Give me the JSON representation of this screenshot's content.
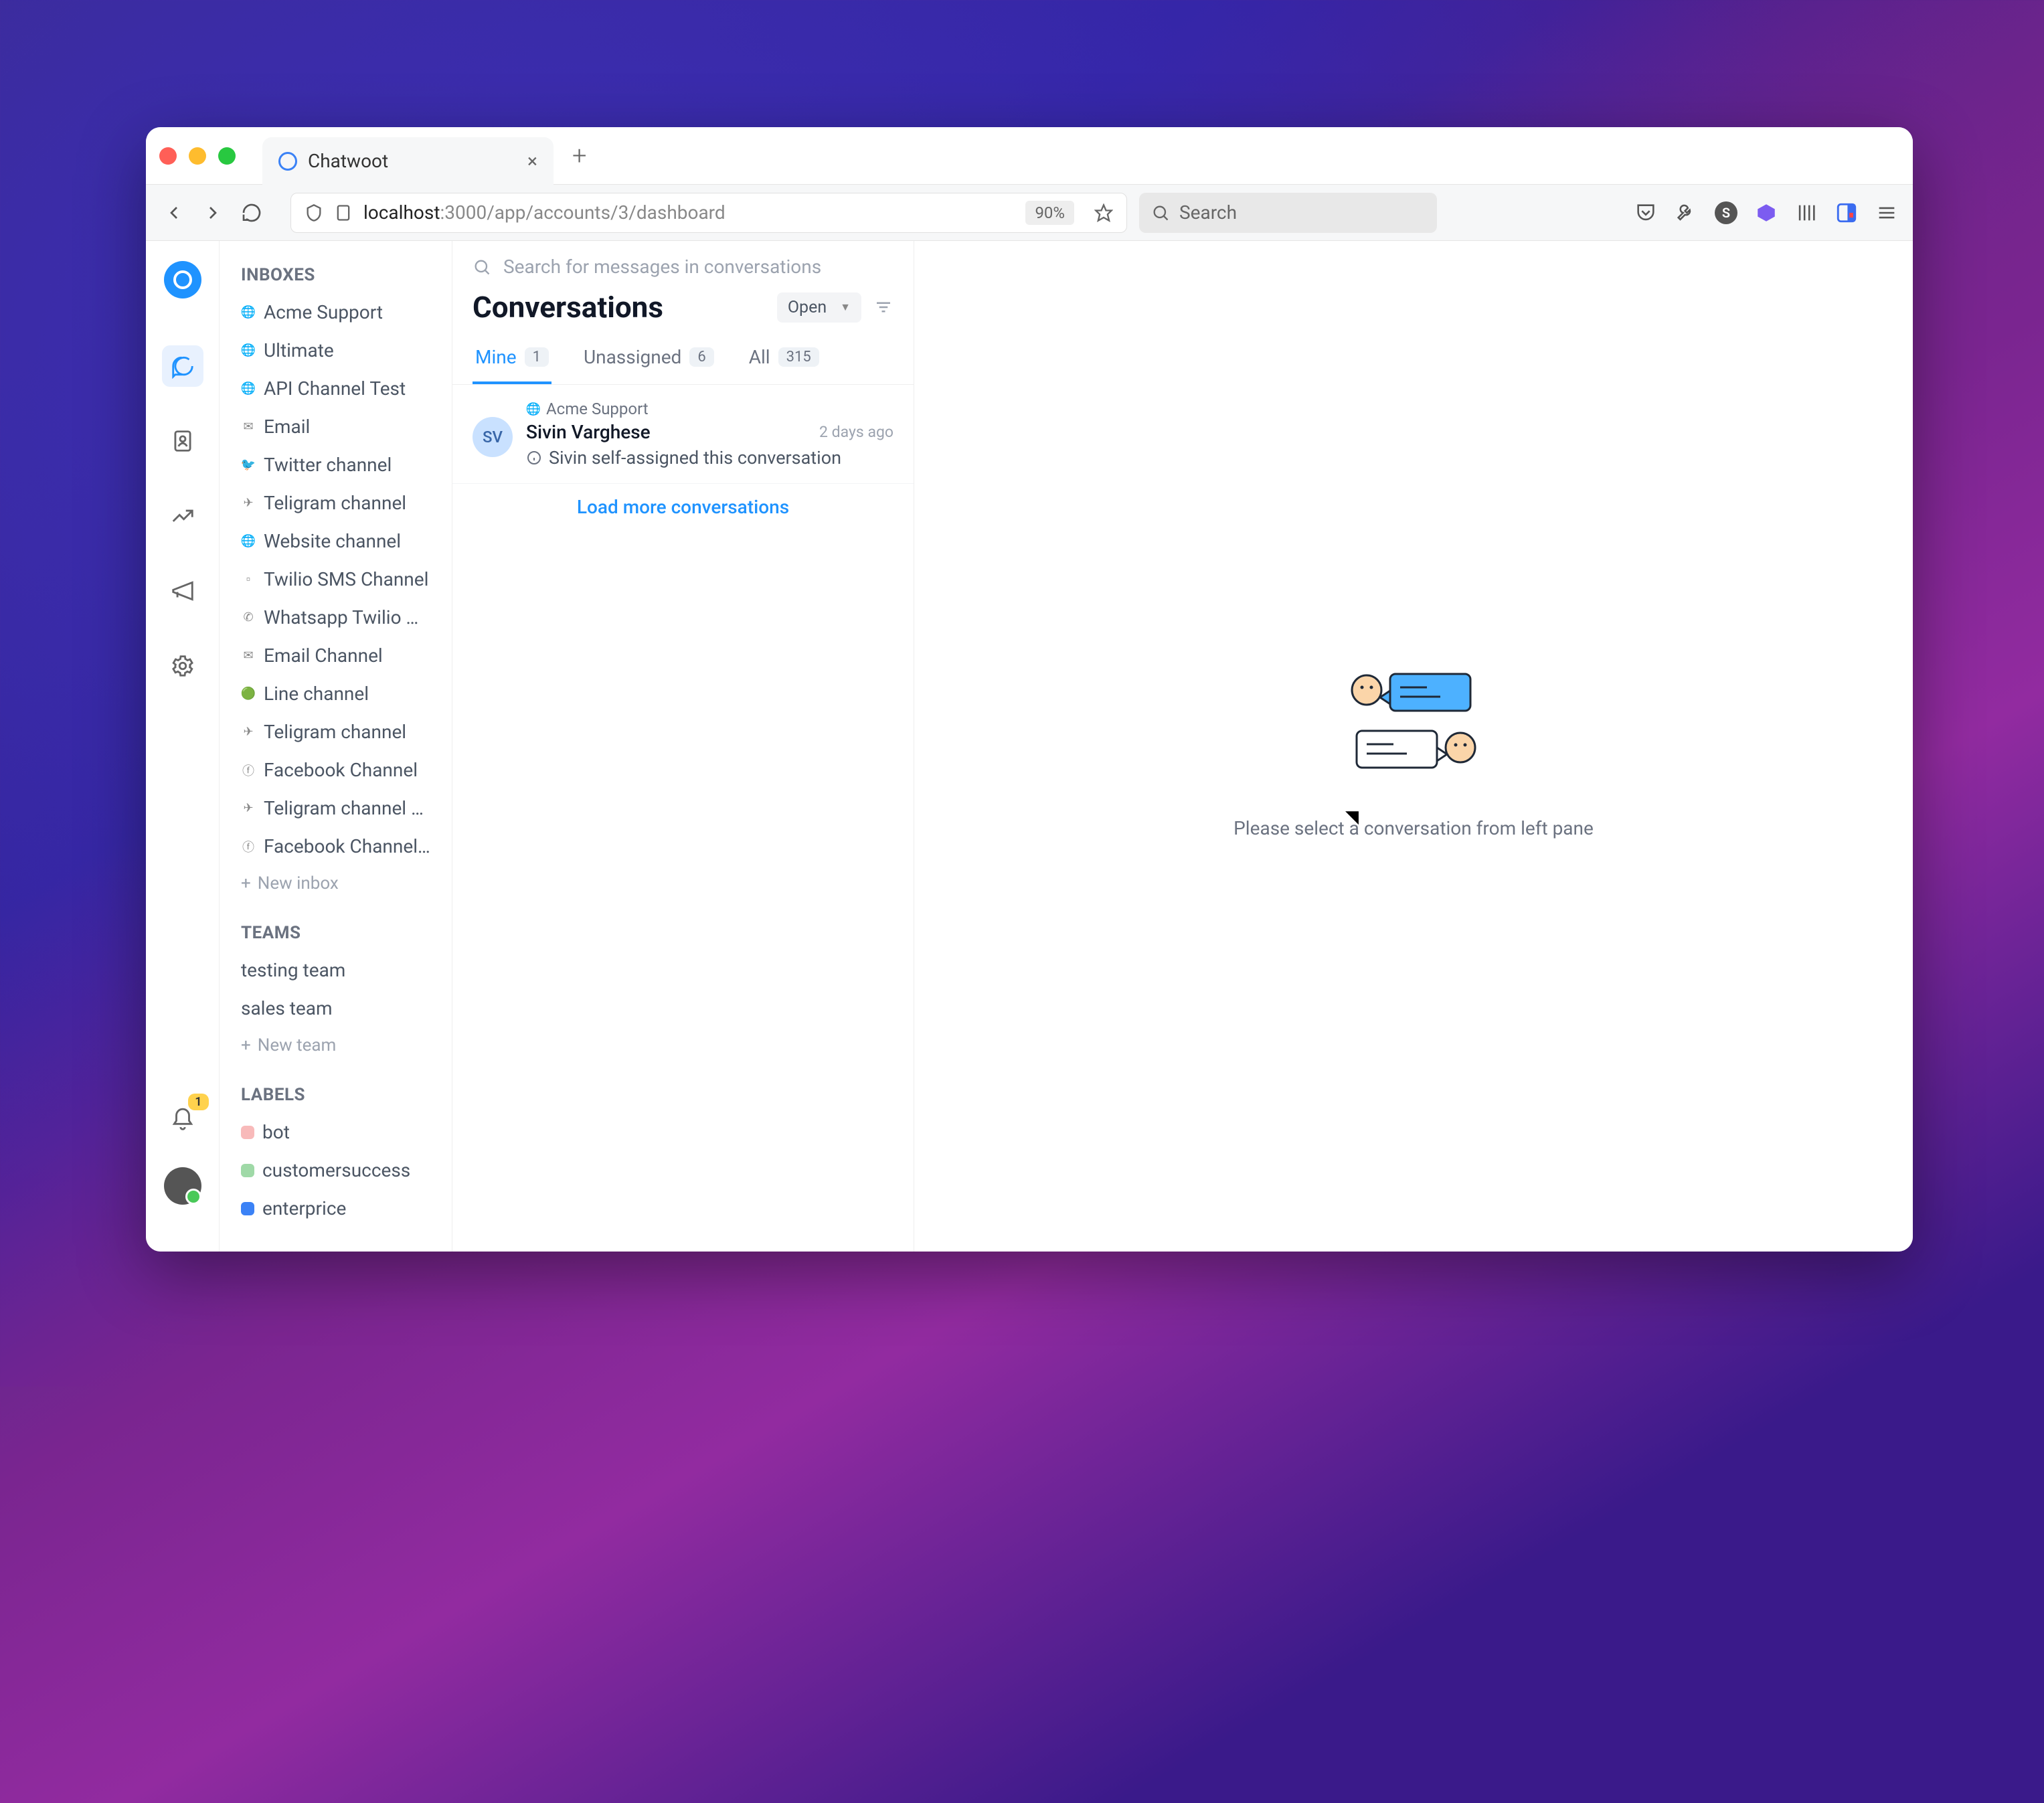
{
  "browser": {
    "tab_title": "Chatwoot",
    "url_host": "localhost",
    "url_path": ":3000/app/accounts/3/dashboard",
    "zoom": "90%",
    "search_placeholder": "Search"
  },
  "rail": {
    "notification_count": "1"
  },
  "sidebar": {
    "inboxes_header": "INBOXES",
    "inboxes": [
      {
        "label": "Acme Support",
        "icon": "globe"
      },
      {
        "label": "Ultimate",
        "icon": "globe"
      },
      {
        "label": "API Channel Test",
        "icon": "globe"
      },
      {
        "label": "Email",
        "icon": "mail"
      },
      {
        "label": "Twitter channel",
        "icon": "twitter"
      },
      {
        "label": "Teligram channel",
        "icon": "telegram"
      },
      {
        "label": "Website channel",
        "icon": "globe"
      },
      {
        "label": "Twilio SMS Channel",
        "icon": "sms"
      },
      {
        "label": "Whatsapp Twilio C...",
        "icon": "whatsapp"
      },
      {
        "label": "Email Channel",
        "icon": "mail"
      },
      {
        "label": "Line channel",
        "icon": "line"
      },
      {
        "label": "Teligram channel",
        "icon": "telegram"
      },
      {
        "label": "Facebook Channel",
        "icon": "facebook"
      },
      {
        "label": "Teligram channel bot",
        "icon": "telegram"
      },
      {
        "label": "Facebook Channel ...",
        "icon": "facebook"
      }
    ],
    "new_inbox": "New inbox",
    "teams_header": "TEAMS",
    "teams": [
      {
        "label": "testing team"
      },
      {
        "label": "sales team"
      }
    ],
    "new_team": "New team",
    "labels_header": "LABELS",
    "labels": [
      {
        "label": "bot",
        "color": "#f8baba"
      },
      {
        "label": "customersuccess",
        "color": "#9fd9a7"
      },
      {
        "label": "enterprice",
        "color": "#3b82f6"
      }
    ]
  },
  "conversations": {
    "search_placeholder": "Search for messages in conversations",
    "title": "Conversations",
    "status_filter": "Open",
    "tabs": [
      {
        "label": "Mine",
        "count": "1",
        "active": true
      },
      {
        "label": "Unassigned",
        "count": "6",
        "active": false
      },
      {
        "label": "All",
        "count": "315",
        "active": false
      }
    ],
    "item": {
      "channel": "Acme Support",
      "avatar_initials": "SV",
      "name": "Sivin Varghese",
      "time": "2 days ago",
      "last_message": "Sivin self-assigned this conversation"
    },
    "load_more": "Load more conversations"
  },
  "main": {
    "empty_text": "Please select a conversation from left pane"
  }
}
